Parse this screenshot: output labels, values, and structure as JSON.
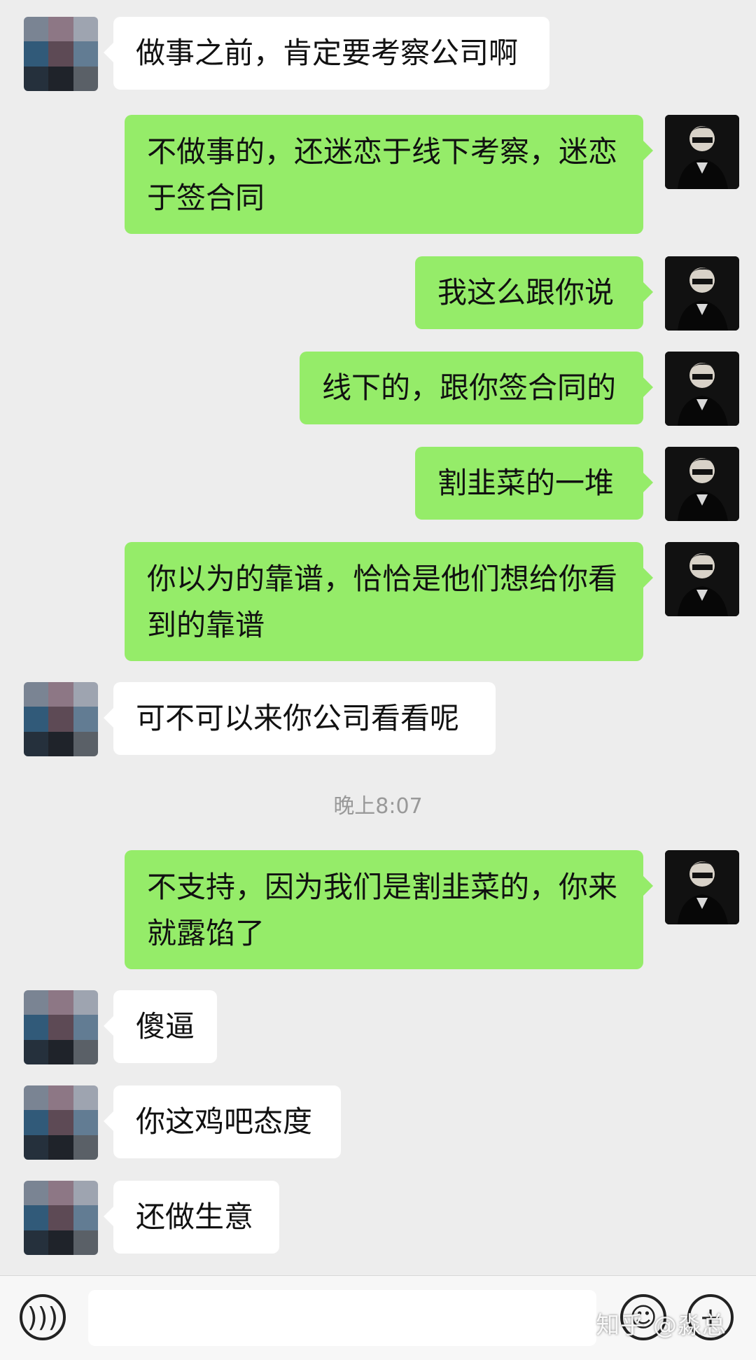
{
  "messages": [
    {
      "side": "left",
      "text": "做事之前，肯定要考察公司啊"
    },
    {
      "side": "right",
      "text": "不做事的，还迷恋于线下考察，迷恋\n于签合同"
    },
    {
      "side": "right",
      "text": "我这么跟你说"
    },
    {
      "side": "right",
      "text": "线下的，跟你签合同的"
    },
    {
      "side": "right",
      "text": "割韭菜的一堆"
    },
    {
      "side": "right",
      "text": "你以为的靠谱，恰恰是他们想给你看\n到的靠谱"
    },
    {
      "side": "left",
      "text": "可不可以来你公司看看呢"
    },
    {
      "side": "time",
      "text": "晚上8:07"
    },
    {
      "side": "right",
      "text": "不支持，因为我们是割韭菜的，你来\n就露馅了"
    },
    {
      "side": "left",
      "text": "傻逼"
    },
    {
      "side": "left",
      "text": "你这鸡吧态度"
    },
    {
      "side": "left",
      "text": "还做生意"
    }
  ],
  "input_bar": {
    "watermark": "知乎 @淼总"
  },
  "icons": {
    "voice": "voice-icon",
    "emoji": "emoji-icon",
    "plus": "plus-icon"
  },
  "colors": {
    "background": "#ededed",
    "self_bubble": "#95ec69",
    "other_bubble": "#ffffff",
    "time_text": "#999999"
  }
}
